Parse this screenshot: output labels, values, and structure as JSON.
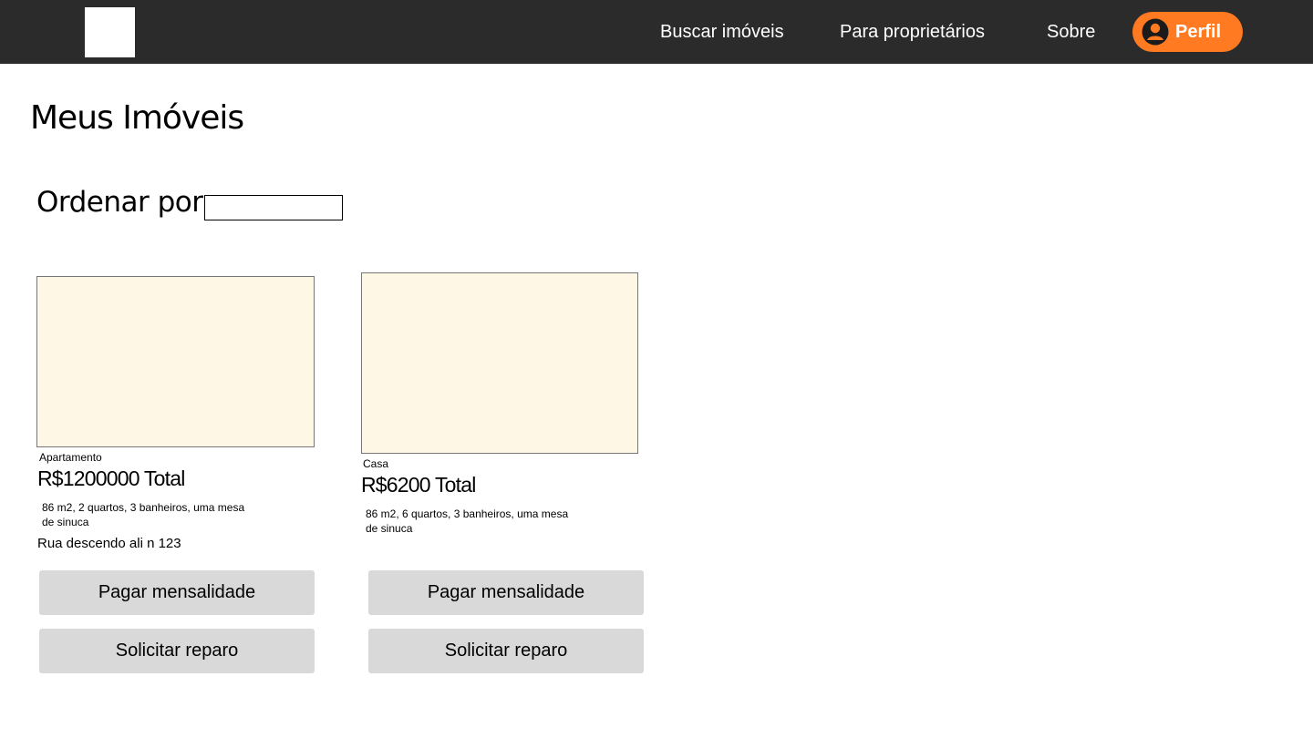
{
  "nav": {
    "links": [
      "Buscar imóveis",
      "Para proprietários",
      "Sobre"
    ],
    "profile_label": "Perfil"
  },
  "page": {
    "title": "Meus Imóveis",
    "sort_label": "Ordenar por:",
    "sort_value": ""
  },
  "properties": [
    {
      "type": "Apartamento",
      "price": "R$1200000 Total",
      "description_line1": "86 m2, 2 quartos, 3 banheiros, uma mesa",
      "description_line2": "de sinuca",
      "address": "Rua descendo ali n 123",
      "pay_label": "Pagar mensalidade",
      "repair_label": "Solicitar reparo"
    },
    {
      "type": "Casa",
      "price": "R$6200 Total",
      "description_line1": "86 m2, 6 quartos, 3 banheiros, uma mesa",
      "description_line2": "de sinuca",
      "address": "",
      "pay_label": "Pagar mensalidade",
      "repair_label": "Solicitar reparo"
    }
  ],
  "colors": {
    "navbar": "#2b2b2b",
    "accent": "#ff7a21",
    "image_placeholder": "#fff7e6",
    "button": "#d9d9d9"
  }
}
